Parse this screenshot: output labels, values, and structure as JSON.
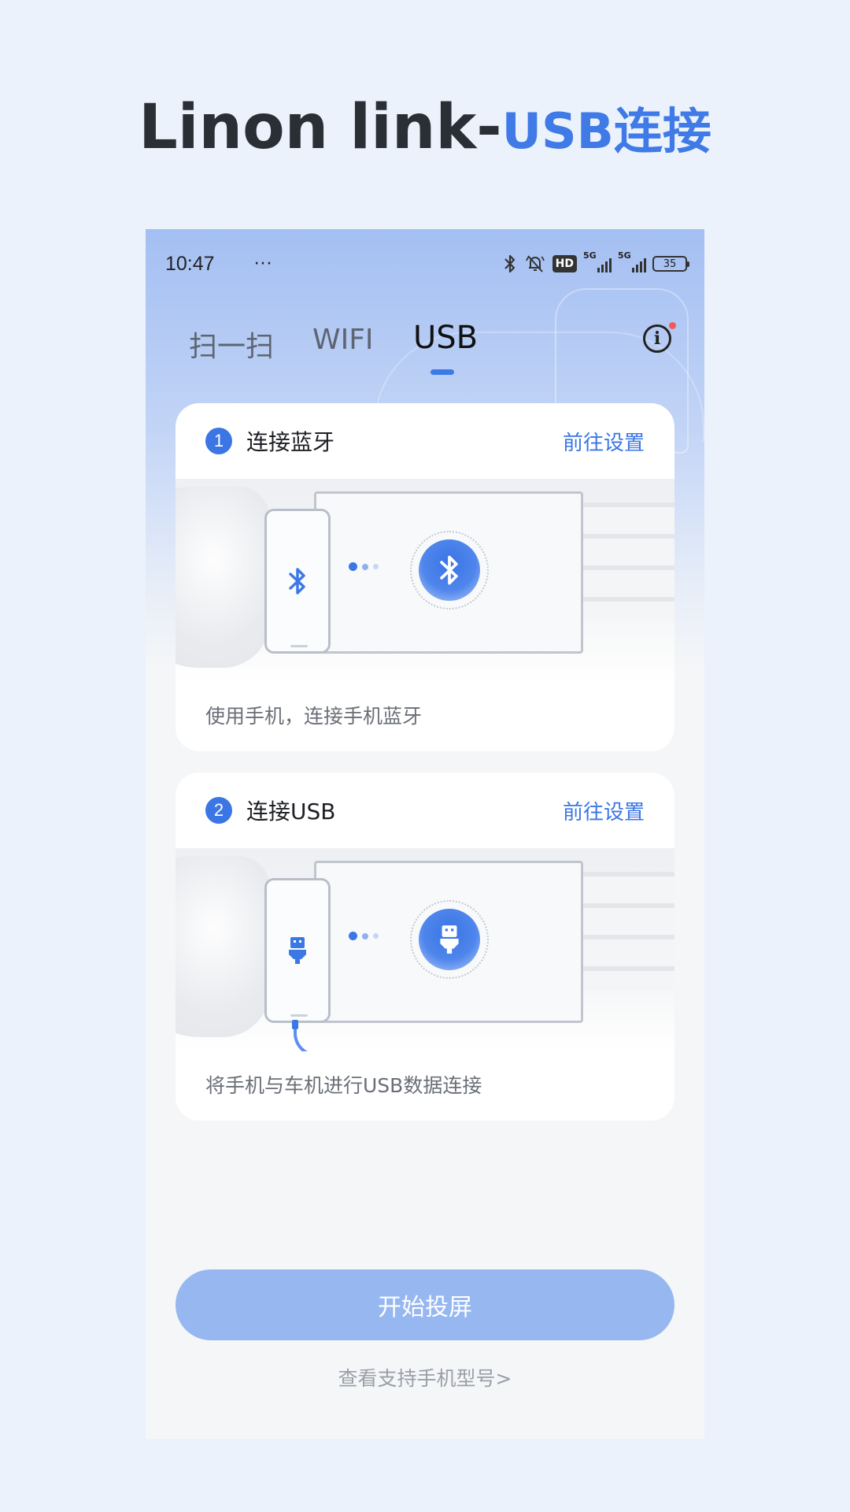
{
  "promo": {
    "title_dark": "Linon link-",
    "title_blue": "USB连接"
  },
  "status_bar": {
    "time": "10:47",
    "more": "···",
    "hd": "HD",
    "net1": "5G",
    "net2": "5G",
    "battery": "35"
  },
  "tabs": [
    {
      "label": "扫一扫",
      "active": false
    },
    {
      "label": "WIFI",
      "active": false
    },
    {
      "label": "USB",
      "active": true
    }
  ],
  "info_icon": "i",
  "steps": [
    {
      "number": "1",
      "title": "连接蓝牙",
      "link": "前往设置",
      "icon": "bluetooth-icon",
      "description": "使用手机，连接手机蓝牙"
    },
    {
      "number": "2",
      "title": "连接USB",
      "link": "前往设置",
      "icon": "usb-icon",
      "description": "将手机与车机进行USB数据连接"
    }
  ],
  "start_button": "开始投屏",
  "support_link": "查看支持手机型号>",
  "colors": {
    "accent": "#3b76e4",
    "button": "#97b7f0",
    "background": "#ebf2fc"
  }
}
